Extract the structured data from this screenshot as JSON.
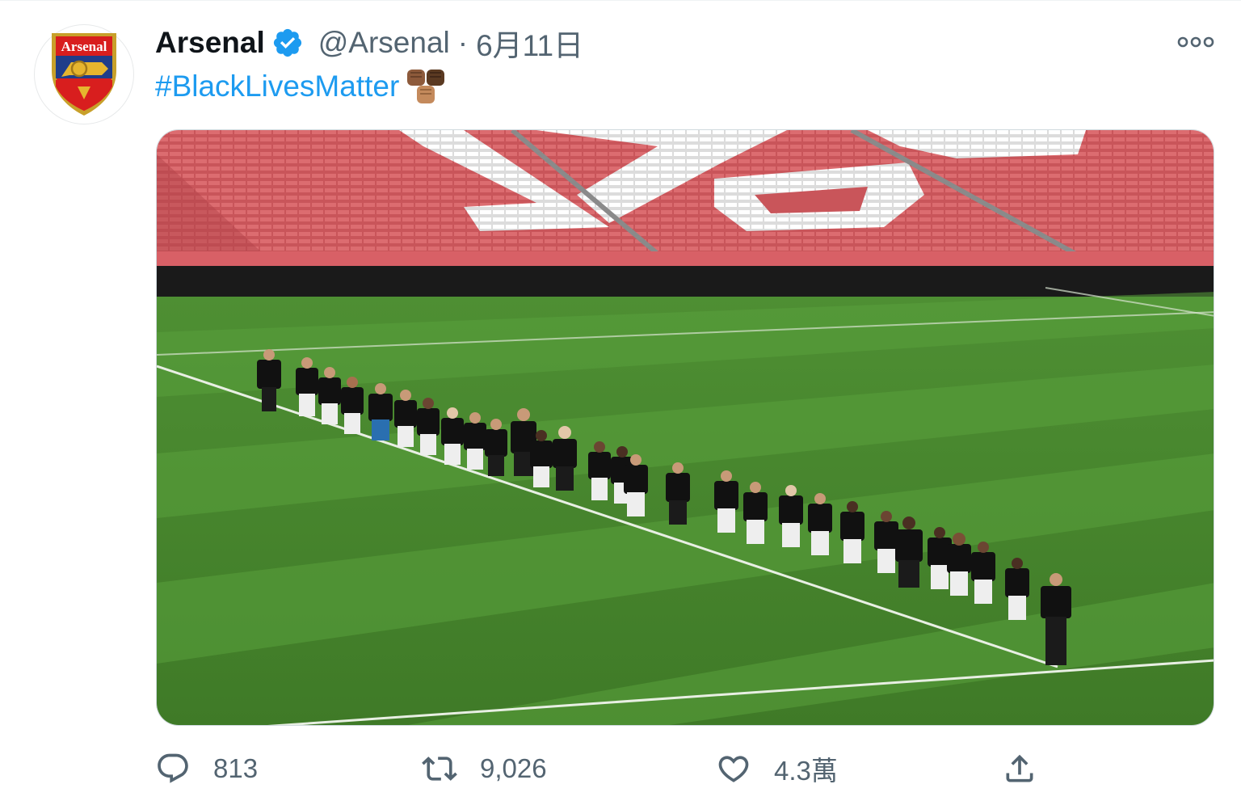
{
  "author": {
    "name": "Arsenal",
    "handle": "@Arsenal",
    "separator": "·",
    "date": "6月11日",
    "avatar_icon": "arsenal-crest",
    "avatar_text": "Arsenal",
    "verified_icon": "verified-badge-icon"
  },
  "tweet": {
    "hashtag": "#BlackLivesMatter",
    "emoji_icon": "raised-fists-emoji"
  },
  "actions": {
    "reply_count": "813",
    "retweet_count": "9,026",
    "like_count": "4.3萬"
  },
  "colors": {
    "accent": "#1d9bf0",
    "secondary_text": "#536471",
    "primary_text": "#0f1419"
  }
}
